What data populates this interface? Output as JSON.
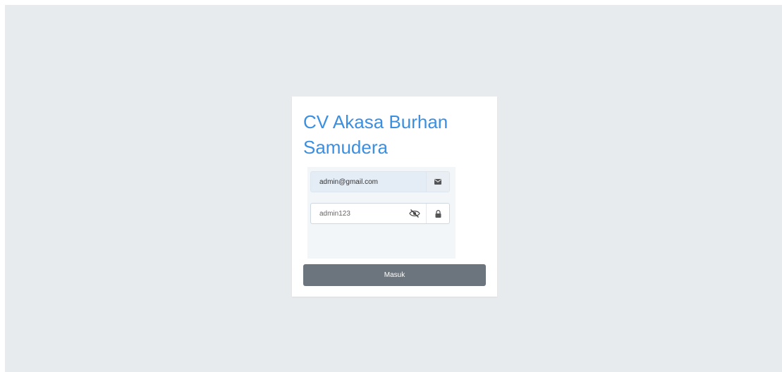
{
  "app": {
    "title": "CV Akasa Burhan Samudera"
  },
  "form": {
    "email": {
      "value": "admin@gmail.com",
      "icon": "envelope-icon"
    },
    "password": {
      "value": "admin123",
      "toggle_icon": "eye-slash-icon",
      "icon": "lock-icon"
    },
    "submit_label": "Masuk"
  },
  "colors": {
    "brand": "#3b8fe0",
    "button": "#6c757d",
    "background": "#e8ebee"
  }
}
